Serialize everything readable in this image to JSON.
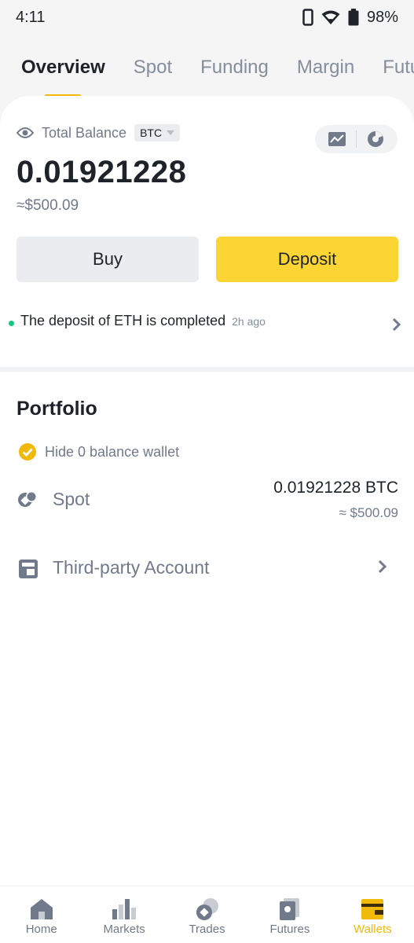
{
  "status_bar": {
    "time": "4:11",
    "battery": "98%",
    "icons": [
      "phone-icon",
      "wifi-icon",
      "battery-icon"
    ]
  },
  "tabs": [
    {
      "label": "Overview",
      "active": true
    },
    {
      "label": "Spot",
      "active": false
    },
    {
      "label": "Funding",
      "active": false
    },
    {
      "label": "Margin",
      "active": false
    },
    {
      "label": "Futu",
      "active": false
    }
  ],
  "overview": {
    "total_balance_label": "Total Balance",
    "coin": "BTC",
    "balance": "0.01921228",
    "fiat": "≈$500.09",
    "buy_label": "Buy",
    "deposit_label": "Deposit",
    "notice_text": "The deposit of ETH is completed",
    "notice_time": "2h ago"
  },
  "portfolio": {
    "title": "Portfolio",
    "hide_zero_label": "Hide 0 balance wallet",
    "hide_zero_checked": true,
    "spot": {
      "label": "Spot",
      "amount": "0.01921228 BTC",
      "fiat": "≈ $500.09"
    },
    "third_party": {
      "label": "Third-party Account"
    }
  },
  "bottom_nav": [
    {
      "label": "Home",
      "icon": "home-icon",
      "active": false
    },
    {
      "label": "Markets",
      "icon": "markets-icon",
      "active": false
    },
    {
      "label": "Trades",
      "icon": "trades-icon",
      "active": false
    },
    {
      "label": "Futures",
      "icon": "futures-icon",
      "active": false
    },
    {
      "label": "Wallets",
      "icon": "wallets-icon",
      "active": true
    }
  ],
  "colors": {
    "accent": "#f0b90b",
    "deposit_button": "#fcd535",
    "success": "#0ecb81",
    "text_primary": "#1e2329",
    "text_secondary": "#707a8a"
  }
}
